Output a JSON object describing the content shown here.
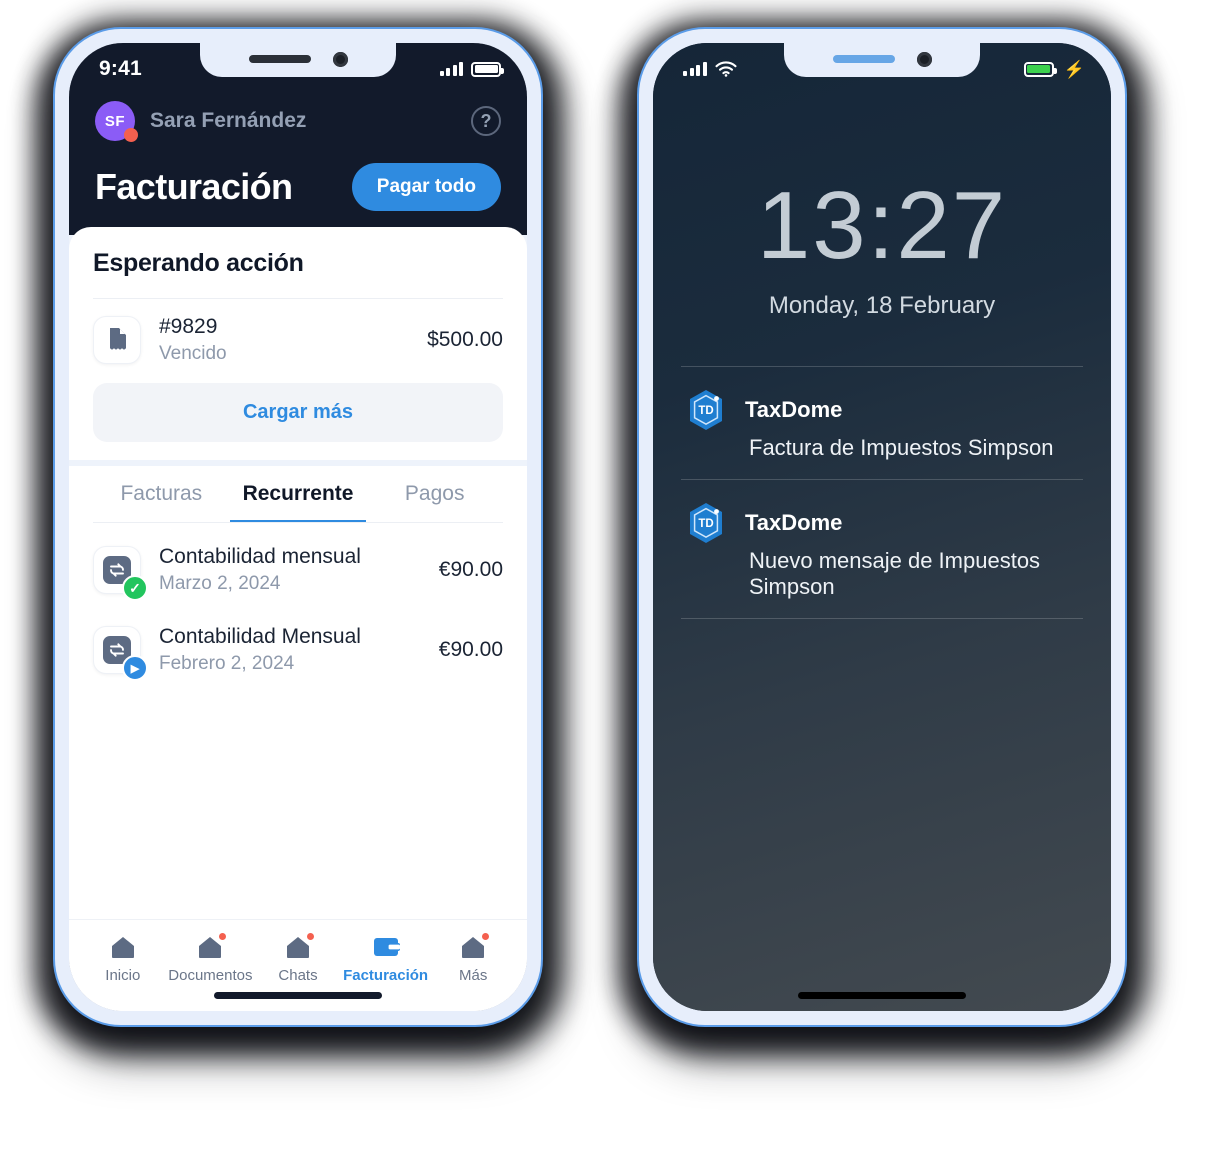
{
  "left_phone": {
    "status_bar": {
      "time": "9:41",
      "signal_icon": "cellular-signal-icon",
      "battery_icon": "battery-icon"
    },
    "header": {
      "avatar_initials": "SF",
      "avatar_badge": "online-dot",
      "user_name": "Sara Fernández",
      "help_icon": "help-circle-icon",
      "help_glyph": "?",
      "title": "Facturación",
      "pay_all_label": "Pagar todo"
    },
    "awaiting_card": {
      "heading": "Esperando acción",
      "items": [
        {
          "icon": "invoice-document-icon",
          "title": "#9829",
          "subtitle": "Vencido",
          "amount": "$500.00"
        }
      ],
      "load_more_label": "Cargar más"
    },
    "tabs": [
      {
        "label": "Facturas",
        "active": false
      },
      {
        "label": "Recurrente",
        "active": true
      },
      {
        "label": "Pagos",
        "active": false
      }
    ],
    "recurring_items": [
      {
        "icon": "recurring-sync-icon",
        "badge": "check-badge",
        "badge_glyph": "✓",
        "badge_color": "#22c55e",
        "title": "Contabilidad mensual",
        "subtitle": "Marzo 2, 2024",
        "amount": "€90.00"
      },
      {
        "icon": "recurring-sync-icon",
        "badge": "play-badge",
        "badge_glyph": "▶",
        "badge_color": "#2f8be0",
        "title": "Contabilidad Mensual",
        "subtitle": "Febrero 2, 2024",
        "amount": "€90.00"
      }
    ],
    "bottom_nav": [
      {
        "label": "Inicio",
        "icon": "home-icon",
        "active": false,
        "dot": false
      },
      {
        "label": "Documentos",
        "icon": "document-icon",
        "active": false,
        "dot": true
      },
      {
        "label": "Chats",
        "icon": "chat-icon",
        "active": false,
        "dot": true
      },
      {
        "label": "Facturación",
        "icon": "wallet-icon",
        "active": true,
        "dot": false
      },
      {
        "label": "Más",
        "icon": "more-icon",
        "active": false,
        "dot": true
      }
    ]
  },
  "right_phone": {
    "status_bar": {
      "signal_icon": "cellular-signal-icon",
      "wifi_icon": "wifi-icon",
      "battery_icon": "battery-charging-icon",
      "charging_glyph": "⚡"
    },
    "lock_screen": {
      "time": "13:27",
      "date": "Monday, 18 February"
    },
    "notifications": [
      {
        "app_icon": "taxdome-hexagon-icon",
        "app_icon_text": "TD",
        "app_name": "TaxDome",
        "body": "Factura de Impuestos Simpson"
      },
      {
        "app_icon": "taxdome-hexagon-icon",
        "app_icon_text": "TD",
        "app_name": "TaxDome",
        "body": "Nuevo mensaje de Impuestos Simpson"
      }
    ]
  },
  "colors": {
    "accent_blue": "#2f8be0",
    "header_dark": "#121a2b",
    "bezel": "#e7eefb",
    "bezel_border": "#5b9ce8",
    "avatar_purple": "#8b5cf6",
    "notification_red": "#f4604f",
    "success_green": "#22c55e",
    "icon_slate": "#5d6b83"
  }
}
